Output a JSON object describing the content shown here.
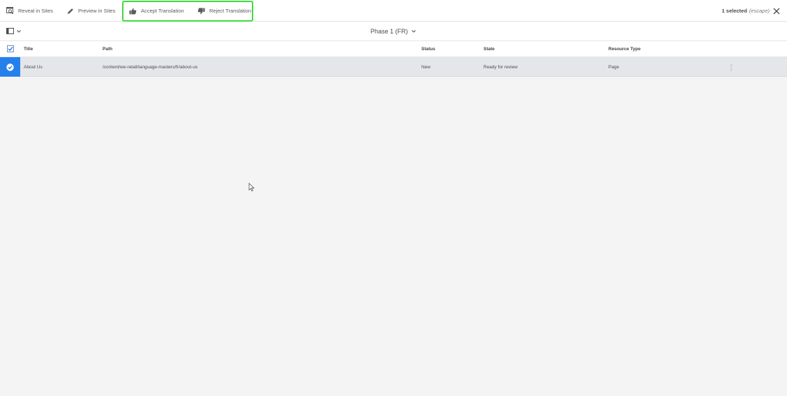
{
  "actionbar": {
    "reveal_label": "Reveal in Sites",
    "preview_label": "Preview in Sites",
    "accept_label": "Accept Translation",
    "reject_label": "Reject Translation",
    "selected_count": "1 selected",
    "escape_hint": "(escape)",
    "highlight_color": "#3ddb3d"
  },
  "titlebar": {
    "title": "Phase 1 (FR)"
  },
  "table": {
    "headers": {
      "title": "Title",
      "path": "Path",
      "status": "Status",
      "state": "State",
      "resource_type": "Resource Type"
    },
    "rows": [
      {
        "title": "About Us",
        "path": "/content/we-retail/language-masters/fr/about-us",
        "status": "New",
        "state": "Ready for review",
        "resource_type": "Page",
        "selected": true
      }
    ]
  },
  "colors": {
    "selection_blue": "#2680eb",
    "selected_row": "#e4e6ea",
    "background": "#f4f4f4"
  },
  "icons": {
    "reveal": "reveal-in-sites-icon",
    "preview": "pencil-icon",
    "accept": "thumbs-up-icon",
    "reject": "thumbs-down-icon",
    "close": "close-icon",
    "view": "card-view-icon",
    "chevron": "chevron-down-icon"
  }
}
